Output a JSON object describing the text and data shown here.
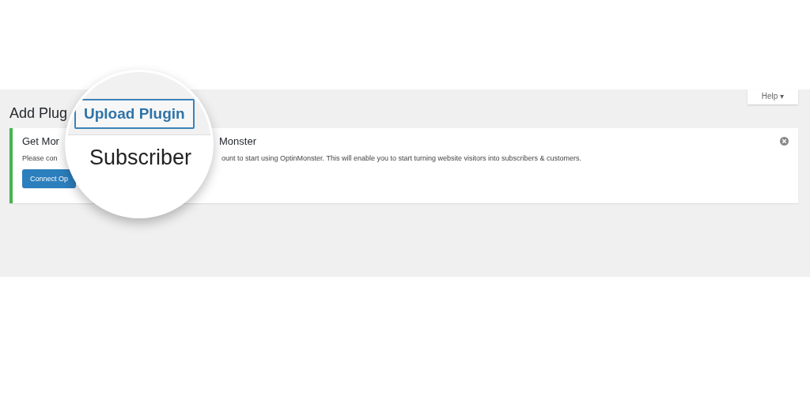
{
  "page": {
    "heading": "Add Plug"
  },
  "help_tab": {
    "label": "Help",
    "caret": "▾"
  },
  "notice": {
    "title_parts": [
      "Get Mor",
      "Monster"
    ],
    "description_parts": [
      "Please con",
      "ount to start using OptinMonster. This will enable you to start turning website visitors into subscribers & customers."
    ],
    "button": "Connect Op",
    "dismissible": true
  },
  "magnifier": {
    "button": "Upload Plugin",
    "text": "Subscriber"
  }
}
